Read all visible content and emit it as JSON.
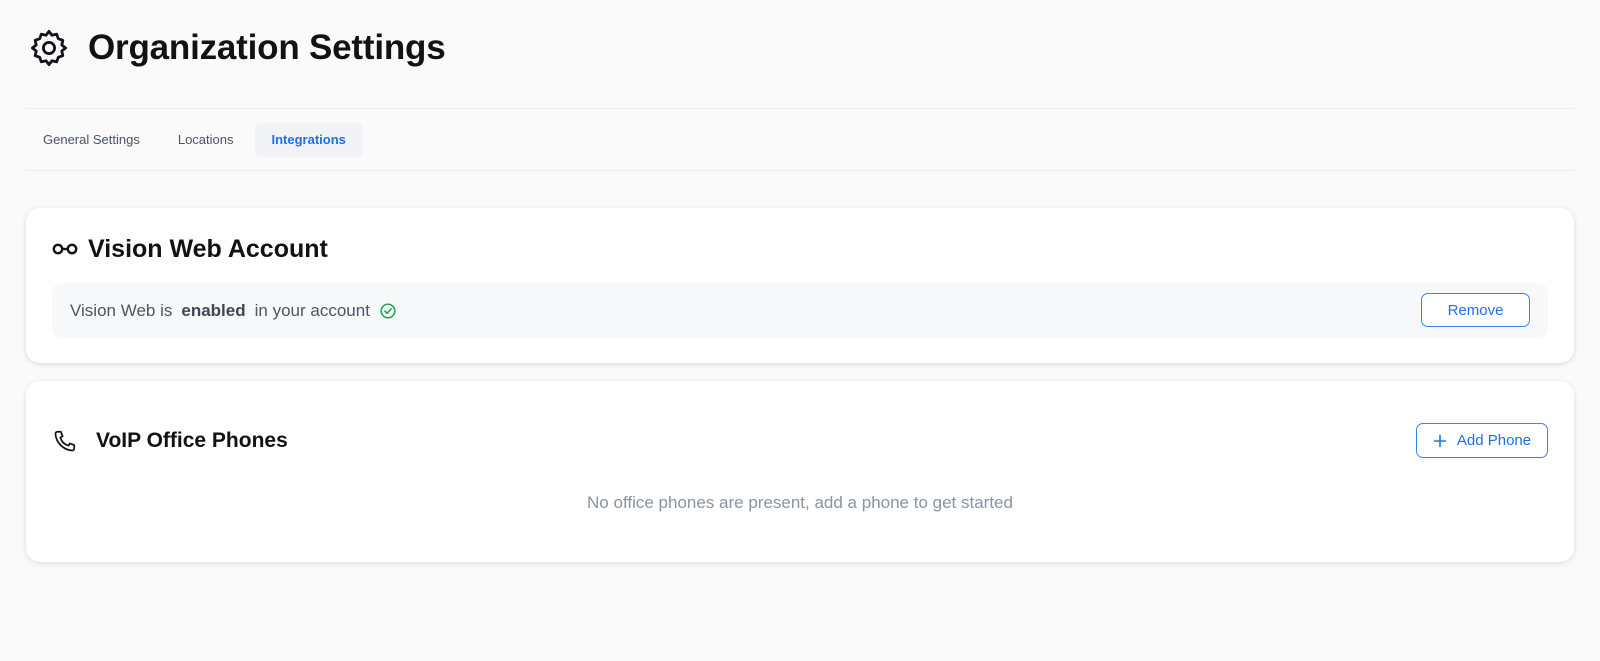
{
  "header": {
    "title": "Organization Settings",
    "icon": "gear-icon"
  },
  "tabs": [
    {
      "label": "General Settings",
      "active": false
    },
    {
      "label": "Locations",
      "active": false
    },
    {
      "label": "Integrations",
      "active": true
    }
  ],
  "vision_web": {
    "title": "Vision Web Account",
    "icon": "glasses-icon",
    "status_prefix": "Vision Web is",
    "status_value": "enabled",
    "status_suffix": "in your account",
    "status_icon": "check-circle-icon",
    "remove_label": "Remove"
  },
  "voip": {
    "title": "VoIP Office Phones",
    "icon": "phone-icon",
    "add_label": "Add Phone",
    "empty_message": "No office phones are present, add a phone to get started"
  },
  "colors": {
    "accent": "#1f6fe5",
    "success": "#22a559",
    "muted_text": "#8a93a0"
  }
}
